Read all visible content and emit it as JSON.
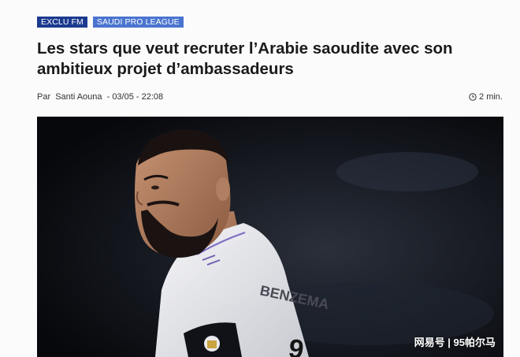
{
  "tags": [
    {
      "label": "EXCLU FM",
      "color": "#1b3a8f"
    },
    {
      "label": "SAUDI PRO LEAGUE",
      "color": "#4a74cf"
    }
  ],
  "article": {
    "title": "Les stars que veut recruter l’Arabie saoudite avec son ambitieux projet d’ambassadeurs",
    "by_label": "Par",
    "author": "Santi Aouna",
    "date": "- 03/05 - 22:08",
    "read_time": "2 min.",
    "read_time_icon": "clock-icon"
  },
  "hero": {
    "jersey_text": "BENZEMA",
    "watermark": "网易号 | 95帕尔马"
  }
}
